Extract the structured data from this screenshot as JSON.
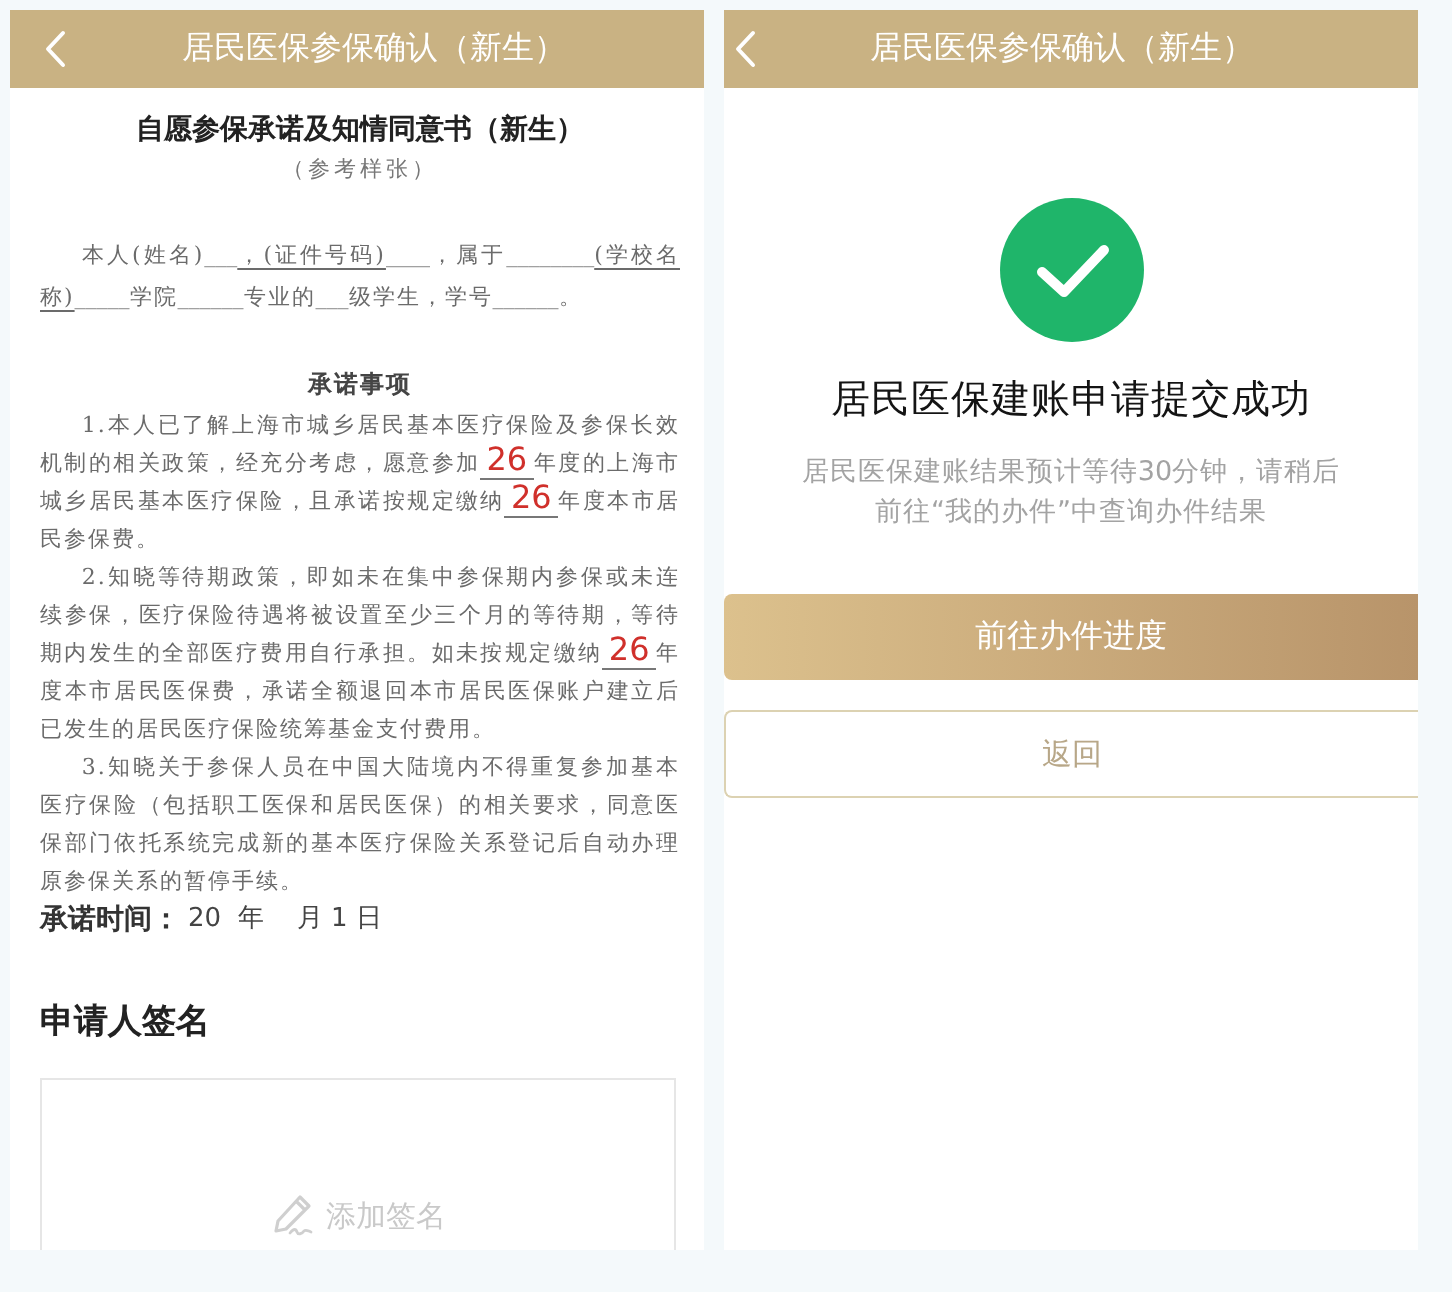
{
  "form_screen": {
    "header": {
      "title": "居民医保参保确认（新生）"
    },
    "document": {
      "title": "自愿参保承诺及知情同意书（新生）",
      "subtitle": "（参考样张）",
      "intro": [
        {
          "kind": "plain",
          "text": "本人(姓名)"
        },
        {
          "kind": "blank",
          "text": "___"
        },
        {
          "kind": "underline",
          "text": "，(证件号码)"
        },
        {
          "kind": "blank",
          "text": "____"
        },
        {
          "kind": "plain",
          "text": "，属于"
        },
        {
          "kind": "blank",
          "text": "________"
        },
        {
          "kind": "underline",
          "text": "(学校名称)"
        },
        {
          "kind": "blank",
          "text": "_____"
        },
        {
          "kind": "plain",
          "text": "学院"
        },
        {
          "kind": "blank",
          "text": "______"
        },
        {
          "kind": "plain",
          "text": "专业的"
        },
        {
          "kind": "blank",
          "text": "___"
        },
        {
          "kind": "plain",
          "text": "级学生，学号"
        },
        {
          "kind": "blank",
          "text": "______"
        },
        {
          "kind": "plain",
          "text": "。"
        }
      ],
      "section_title": "承诺事项",
      "items": [
        [
          {
            "kind": "plain",
            "text": "1.本人已了解上海市城乡居民基本医疗保险及参保长效机制的相关政策，经充分考虑，愿意参加"
          },
          {
            "kind": "fill",
            "text": "26"
          },
          {
            "kind": "plain",
            "text": "年度的上海市城乡居民基本医疗保险，且承诺按规定缴纳"
          },
          {
            "kind": "fill",
            "text": "26"
          },
          {
            "kind": "plain",
            "text": "年度本市居民参保费。"
          }
        ],
        [
          {
            "kind": "plain",
            "text": "2.知晓等待期政策，即如未在集中参保期内参保或未连续参保，医疗保险待遇将被设置至少三个月的等待期，等待期内发生的全部医疗费用自行承担。如未按规定缴纳"
          },
          {
            "kind": "fill",
            "text": "26"
          },
          {
            "kind": "plain",
            "text": "年度本市居民医保费，承诺全额退回本市居民医保账户建立后已发生的居民医疗保险统筹基金支付费用。"
          }
        ],
        [
          {
            "kind": "plain",
            "text": "3.知晓关于参保人员在中国大陆境内不得重复参加基本医疗保险（包括职工医保和居民医保）的相关要求，同意医保部门依托系统完成新的基本医疗保险关系登记后自动办理原参保关系的暂停手续。"
          }
        ]
      ],
      "date_label": "承诺时间：",
      "date_value": "20  年    月 1 日"
    },
    "signature": {
      "title": "申请人签名",
      "placeholder": "添加签名"
    }
  },
  "result_screen": {
    "header": {
      "title": "居民医保参保确认（新生）"
    },
    "title": "居民医保建账申请提交成功",
    "message": "居民医保建账结果预计等待30分钟，请稍后前往“我的办件”中查询办件结果",
    "buttons": [
      {
        "kind": "primary",
        "label": "前往办件进度"
      },
      {
        "kind": "secondary",
        "label": "返回"
      }
    ]
  }
}
